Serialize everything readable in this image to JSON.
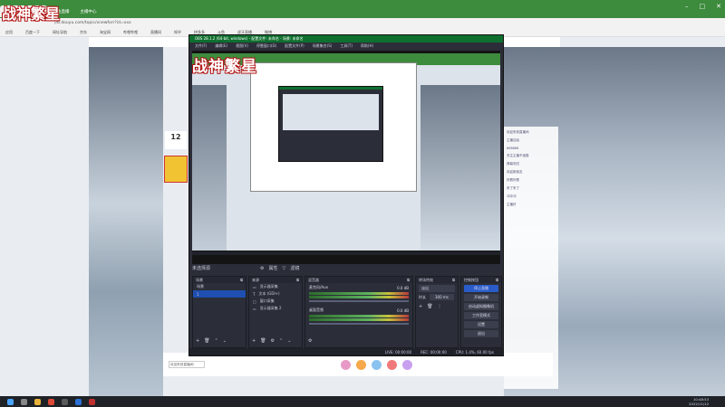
{
  "browser": {
    "tabs": [
      {
        "label": "战神繁星 - 斗鱼直播"
      },
      {
        "label": "斗鱼直播"
      },
      {
        "label": "主播中心"
      }
    ],
    "url": "//b.douyu.com/topic/vnewforr?id=xxx",
    "bookmarks": [
      "应用",
      "百度一下",
      "网址导航",
      "京东",
      "淘宝网",
      "哔哩哔哩",
      "直播间",
      "知乎",
      "拼多多",
      "斗鱼",
      "虎牙直播",
      "微博"
    ]
  },
  "logo_text": "战神繁星",
  "obs": {
    "title": "OBS 28.1.2 (64-bit, windows) - 配置文件: 未命名 - 场景: 未命名",
    "menu": [
      "文件(F)",
      "编辑(E)",
      "视图(V)",
      "停靠窗口(D)",
      "配置文件(P)",
      "场景集合(S)",
      "工具(T)",
      "帮助(H)"
    ],
    "toolbar": {
      "source_label": "未选择源",
      "properties": "属性",
      "filters": "滤镜"
    },
    "docks": {
      "scenes": {
        "title": "场景",
        "items": [
          "场景",
          "1"
        ]
      },
      "sources": {
        "title": "来源",
        "items": [
          "显示器采集",
          "文本 (GDI+)",
          "窗口采集",
          "显示器采集 2"
        ]
      },
      "mixer": {
        "title": "混音器",
        "channels": [
          {
            "name": "麦克风/Aux",
            "level": "0.0 dB"
          },
          {
            "name": "桌面音频",
            "level": "0.0 dB"
          }
        ]
      },
      "transitions": {
        "title": "转场特效",
        "selected": "淡出",
        "duration_label": "时长",
        "duration_value": "300 ms"
      },
      "controls": {
        "title": "控制按钮",
        "buttons": [
          "停止直播",
          "开始录制",
          "启动虚拟摄像机",
          "工作室模式",
          "设置",
          "退出"
        ]
      }
    },
    "status": {
      "live": "LIVE: 00:00:00",
      "rec": "REC: 00:00:00",
      "cpu": "CPU: 1.4%, 60.00 fps"
    }
  },
  "page": {
    "viewer_count": "12",
    "chat_lines": [
      "欢迎来到直播间",
      "主播加油",
      "666666",
      "关注主播不迷路",
      "弹幕测试",
      "欢迎新朋友",
      "好看好看",
      "来了来了",
      "冲冲冲",
      "主播好"
    ],
    "bottom_input": "欢迎来到直播间!"
  },
  "clock": {
    "time": "10:48:53",
    "date": "2022/11/12"
  },
  "colors": {
    "chrome_green": "#3d8b3d",
    "obs_bg": "#2b2e38",
    "accent_red": "#b01010",
    "stop_button_blue": "#2a5cc9"
  }
}
